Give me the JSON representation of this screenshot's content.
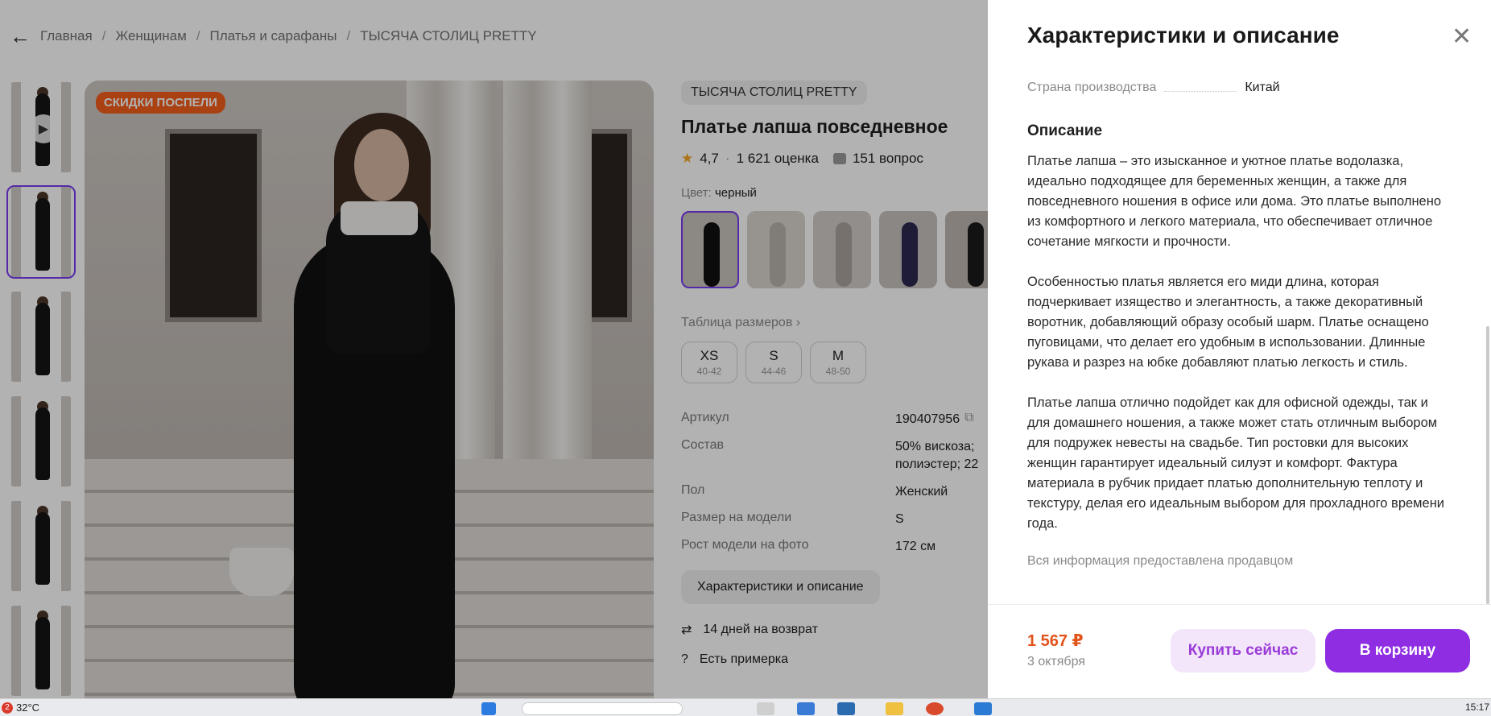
{
  "breadcrumbs": {
    "items": [
      "Главная",
      "Женщинам",
      "Платья и сарафаны",
      "ТЫСЯЧА СТОЛИЦ PRETTY"
    ],
    "separator": "/"
  },
  "gallery": {
    "badge": "СКИДКИ ПОСПЕЛИ",
    "thumbnails_count": 6,
    "selected_index": 1
  },
  "product": {
    "brand": "ТЫСЯЧА СТОЛИЦ PRETTY",
    "title": "Платье лапша повседневное",
    "rating": "4,7",
    "reviews": "1 621 оценка",
    "questions": "151 вопрос",
    "color_label": "Цвет:",
    "color_value": "черный",
    "size_table_link": "Таблица размеров",
    "sizes": [
      {
        "label": "XS",
        "range": "40-42"
      },
      {
        "label": "S",
        "range": "44-46"
      },
      {
        "label": "M",
        "range": "48-50"
      }
    ],
    "specs": [
      {
        "key": "Артикул",
        "value": "190407956"
      },
      {
        "key": "Состав",
        "value": "50% вискоза; полиэстер; 22"
      },
      {
        "key": "Пол",
        "value": "Женский"
      },
      {
        "key": "Размер на модели",
        "value": "S"
      },
      {
        "key": "Рост модели на фото",
        "value": "172 см"
      }
    ],
    "characteristics_button": "Характеристики и описание",
    "returns": "14 дней на возврат",
    "fitting": "Есть примерка"
  },
  "drawer": {
    "title": "Характеристики и описание",
    "country_key": "Страна производства",
    "country_value": "Китай",
    "description_heading": "Описание",
    "paragraphs": [
      "Платье лапша – это изысканное и уютное платье водолазка, идеально подходящее для беременных женщин, а также для повседневного ношения в офисе или дома. Это платье выполнено из комфортного и легкого материала, что обеспечивает отличное сочетание мягкости и прочности.",
      "Особенностью платья является его миди длина, которая подчеркивает изящество и элегантность, а также декоративный воротник, добавляющий образу особый шарм. Платье оснащено пуговицами, что делает его удобным в использовании. Длинные рукава и разрез на юбке добавляют платью легкость и стиль.",
      "Платье лапша отлично подойдет как для офисной одежды, так и для домашнего ношения, а также может стать отличным выбором для подружек невесты на свадьбе. Тип ростовки для высоких женщин гарантирует идеальный силуэт и комфорт. Фактура материала в рубчик придает платью дополнительную теплоту и текстуру, делая его идеальным выбором для прохладного времени года."
    ],
    "seller_note": "Вся информация предоставлена продавцом",
    "price": "1 567 ₽",
    "delivery_date": "3 октября",
    "buy_now_label": "Купить сейчас",
    "add_to_cart_label": "В корзину"
  },
  "taskbar": {
    "weather_badge": "2",
    "temperature": "32°C",
    "time": "15:17"
  },
  "colors": {
    "accent": "#8e2de2",
    "price": "#e2531a",
    "badge": "#f25d1c",
    "selection": "#7a3cf0"
  }
}
